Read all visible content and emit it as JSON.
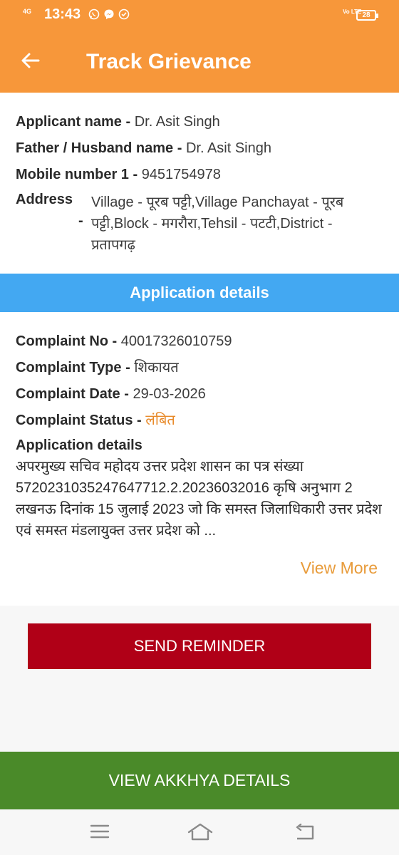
{
  "status_bar": {
    "network": "4G",
    "time": "13:43",
    "app_icons": [
      "whatsapp-icon",
      "messenger-icon",
      "clock-check-icon"
    ],
    "volte": "Vo LTE",
    "battery": "28"
  },
  "toolbar": {
    "title": "Track Grievance",
    "back_icon": "arrow-left-icon"
  },
  "applicant": {
    "name_label": "Applicant name",
    "name_value": "Dr. Asit Singh",
    "father_label": "Father / Husband name",
    "father_value": "Dr. Asit Singh",
    "mobile_label": "Mobile number 1",
    "mobile_value": "9451754978",
    "address_label": "Address",
    "address_value": "Village - पूरब पट्टी,Village Panchayat - पूरब पट्टी,Block - मगरौरा,Tehsil - पटटी,District - प्रतापगढ़"
  },
  "application": {
    "section_title": "Application details",
    "complaint_no_label": "Complaint No",
    "complaint_no_value": "40017326010759",
    "complaint_type_label": "Complaint Type",
    "complaint_type_value": "शिकायत",
    "complaint_date_label": "Complaint Date",
    "complaint_date_value": "29-03-2026",
    "complaint_status_label": "Complaint Status",
    "complaint_status_value": "लंबित",
    "details_label": "Application details",
    "details_text": "अपरमुख्य सचिव महोदय उत्तर प्रदेश शासन का पत्र संख्या 5720231035247647712.2.20236032016 कृषि अनुभाग 2 लखनऊ दिनांक 15 जुलाई 2023 जो कि समस्त जिलाधिकारी उत्तर प्रदेश एवं समस्त मंडलायुक्त उत्तर प्रदेश को ...",
    "view_more": "View More"
  },
  "actions": {
    "send_reminder": "SEND REMINDER",
    "view_akkhya": "VIEW AKKHYA DETAILS"
  },
  "colors": {
    "header": "#f7973a",
    "section": "#43a8f2",
    "reminder_button": "#b00017",
    "akkhya_button": "#4a8a29",
    "status": "#e88a2a"
  },
  "nav_bar": [
    "menu-icon",
    "home-icon",
    "back-icon"
  ]
}
